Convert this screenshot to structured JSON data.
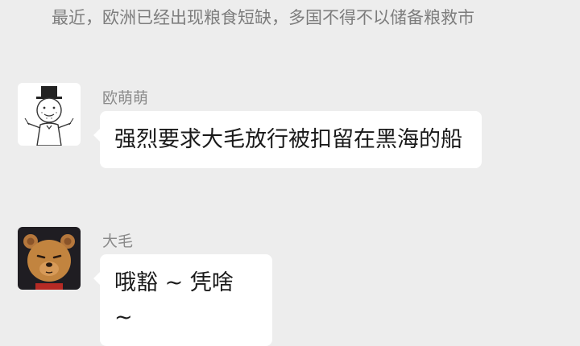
{
  "preview": {
    "text": "最近，欧洲已经出现粮食短缺，多国不得不以储备粮救市"
  },
  "messages": [
    {
      "sender": "欧萌萌",
      "avatar_icon": "tophat-cartoon-avatar-icon",
      "text": "强烈要求大毛放行被扣留在黑海的船"
    },
    {
      "sender": "大毛",
      "avatar_icon": "bear-avatar-icon",
      "text": "哦豁 ~ 凭啥 ~"
    }
  ]
}
